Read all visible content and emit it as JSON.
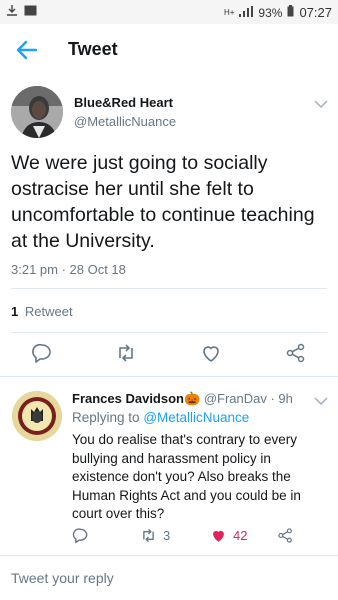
{
  "status_bar": {
    "left_icons": [
      "download-icon",
      "image-icon"
    ],
    "network": "H+",
    "battery": "93%",
    "time": "07:27"
  },
  "header": {
    "title": "Tweet",
    "back_icon": "arrow-left-icon"
  },
  "tweet": {
    "display_name": "Blue&Red Heart",
    "handle": "@MetallicNuance",
    "text": "We were just going to socially ostracise her until she felt to uncomfortable to continue teaching at the University.",
    "timestamp": "3:21 pm · 28 Oct 18",
    "retweet_count": "1",
    "retweet_label": "Retweet"
  },
  "reply": {
    "display_name": "Frances Davidson",
    "name_emoji": "🎃",
    "handle": "@FranDav",
    "age": "· 9h",
    "replying_prefix": "Replying to",
    "replying_to": "@MetallicNuance",
    "text": "You do realise that's contrary to every bullying and harassment policy in existence don't you? Also breaks the Human Rights Act and you could be in court over this?",
    "retweet_count": "3",
    "like_count": "42"
  },
  "compose": {
    "placeholder": "Tweet your reply"
  },
  "colors": {
    "accent": "#1da1f2",
    "like": "#e0245e",
    "muted": "#657786"
  }
}
